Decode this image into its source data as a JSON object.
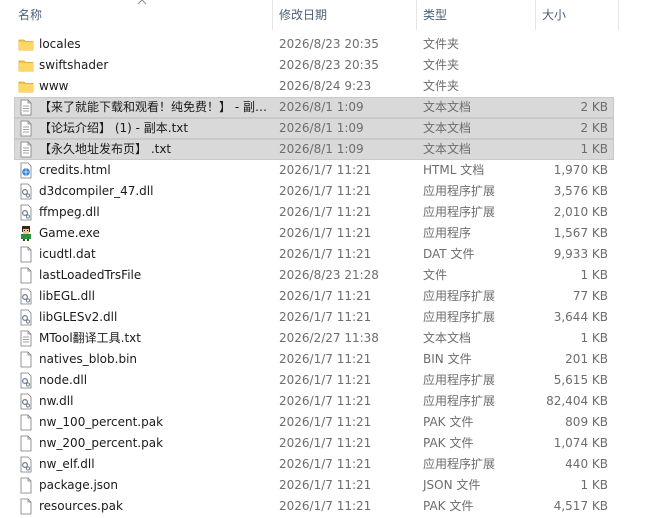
{
  "columns": {
    "name": "名称",
    "modified": "修改日期",
    "type": "类型",
    "size": "大小"
  },
  "rows": [
    {
      "name": "locales",
      "date": "2026/8/23 20:35",
      "type": "文件夹",
      "size": "",
      "icon": "folder-icon",
      "selected": false
    },
    {
      "name": "swiftshader",
      "date": "2026/8/23 20:35",
      "type": "文件夹",
      "size": "",
      "icon": "folder-icon",
      "selected": false
    },
    {
      "name": "www",
      "date": "2026/8/24 9:23",
      "type": "文件夹",
      "size": "",
      "icon": "folder-icon",
      "selected": false
    },
    {
      "name": "【来了就能下载和观看！纯免费！】 - 副…",
      "date": "2026/8/1 1:09",
      "type": "文本文档",
      "size": "2 KB",
      "icon": "text-file-icon",
      "selected": true
    },
    {
      "name": "【论坛介绍】 (1) - 副本.txt",
      "date": "2026/8/1 1:09",
      "type": "文本文档",
      "size": "2 KB",
      "icon": "text-file-icon",
      "selected": true
    },
    {
      "name": "【永久地址发布页】 .txt",
      "date": "2026/8/1 1:09",
      "type": "文本文档",
      "size": "1 KB",
      "icon": "text-file-icon",
      "selected": true
    },
    {
      "name": "credits.html",
      "date": "2026/1/7 11:21",
      "type": "HTML 文档",
      "size": "1,970 KB",
      "icon": "html-file-icon",
      "selected": false
    },
    {
      "name": "d3dcompiler_47.dll",
      "date": "2026/1/7 11:21",
      "type": "应用程序扩展",
      "size": "3,576 KB",
      "icon": "dll-file-icon",
      "selected": false
    },
    {
      "name": "ffmpeg.dll",
      "date": "2026/1/7 11:21",
      "type": "应用程序扩展",
      "size": "2,010 KB",
      "icon": "dll-file-icon",
      "selected": false
    },
    {
      "name": "Game.exe",
      "date": "2026/1/7 11:21",
      "type": "应用程序",
      "size": "1,567 KB",
      "icon": "game-exe-icon",
      "selected": false
    },
    {
      "name": "icudtl.dat",
      "date": "2026/1/7 11:21",
      "type": "DAT 文件",
      "size": "9,933 KB",
      "icon": "blank-file-icon",
      "selected": false
    },
    {
      "name": "lastLoadedTrsFile",
      "date": "2026/8/23 21:28",
      "type": "文件",
      "size": "1 KB",
      "icon": "blank-file-icon",
      "selected": false
    },
    {
      "name": "libEGL.dll",
      "date": "2026/1/7 11:21",
      "type": "应用程序扩展",
      "size": "77 KB",
      "icon": "dll-file-icon",
      "selected": false
    },
    {
      "name": "libGLESv2.dll",
      "date": "2026/1/7 11:21",
      "type": "应用程序扩展",
      "size": "3,644 KB",
      "icon": "dll-file-icon",
      "selected": false
    },
    {
      "name": "MTool翻译工具.txt",
      "date": "2026/2/27 11:38",
      "type": "文本文档",
      "size": "1 KB",
      "icon": "text-file-icon",
      "selected": false
    },
    {
      "name": "natives_blob.bin",
      "date": "2026/1/7 11:21",
      "type": "BIN 文件",
      "size": "201 KB",
      "icon": "blank-file-icon",
      "selected": false
    },
    {
      "name": "node.dll",
      "date": "2026/1/7 11:21",
      "type": "应用程序扩展",
      "size": "5,615 KB",
      "icon": "dll-file-icon",
      "selected": false
    },
    {
      "name": "nw.dll",
      "date": "2026/1/7 11:21",
      "type": "应用程序扩展",
      "size": "82,404 KB",
      "icon": "dll-file-icon",
      "selected": false
    },
    {
      "name": "nw_100_percent.pak",
      "date": "2026/1/7 11:21",
      "type": "PAK 文件",
      "size": "809 KB",
      "icon": "blank-file-icon",
      "selected": false
    },
    {
      "name": "nw_200_percent.pak",
      "date": "2026/1/7 11:21",
      "type": "PAK 文件",
      "size": "1,074 KB",
      "icon": "blank-file-icon",
      "selected": false
    },
    {
      "name": "nw_elf.dll",
      "date": "2026/1/7 11:21",
      "type": "应用程序扩展",
      "size": "440 KB",
      "icon": "dll-file-icon",
      "selected": false
    },
    {
      "name": "package.json",
      "date": "2026/1/7 11:21",
      "type": "JSON 文件",
      "size": "1 KB",
      "icon": "blank-file-icon",
      "selected": false
    },
    {
      "name": "resources.pak",
      "date": "2026/1/7 11:21",
      "type": "PAK 文件",
      "size": "4,517 KB",
      "icon": "blank-file-icon",
      "selected": false
    }
  ],
  "colors": {
    "folder": "#f6c344",
    "selected_bg": "#d9d9d9",
    "header_text": "#4c607a",
    "secondary_text": "#6d6d6d"
  }
}
